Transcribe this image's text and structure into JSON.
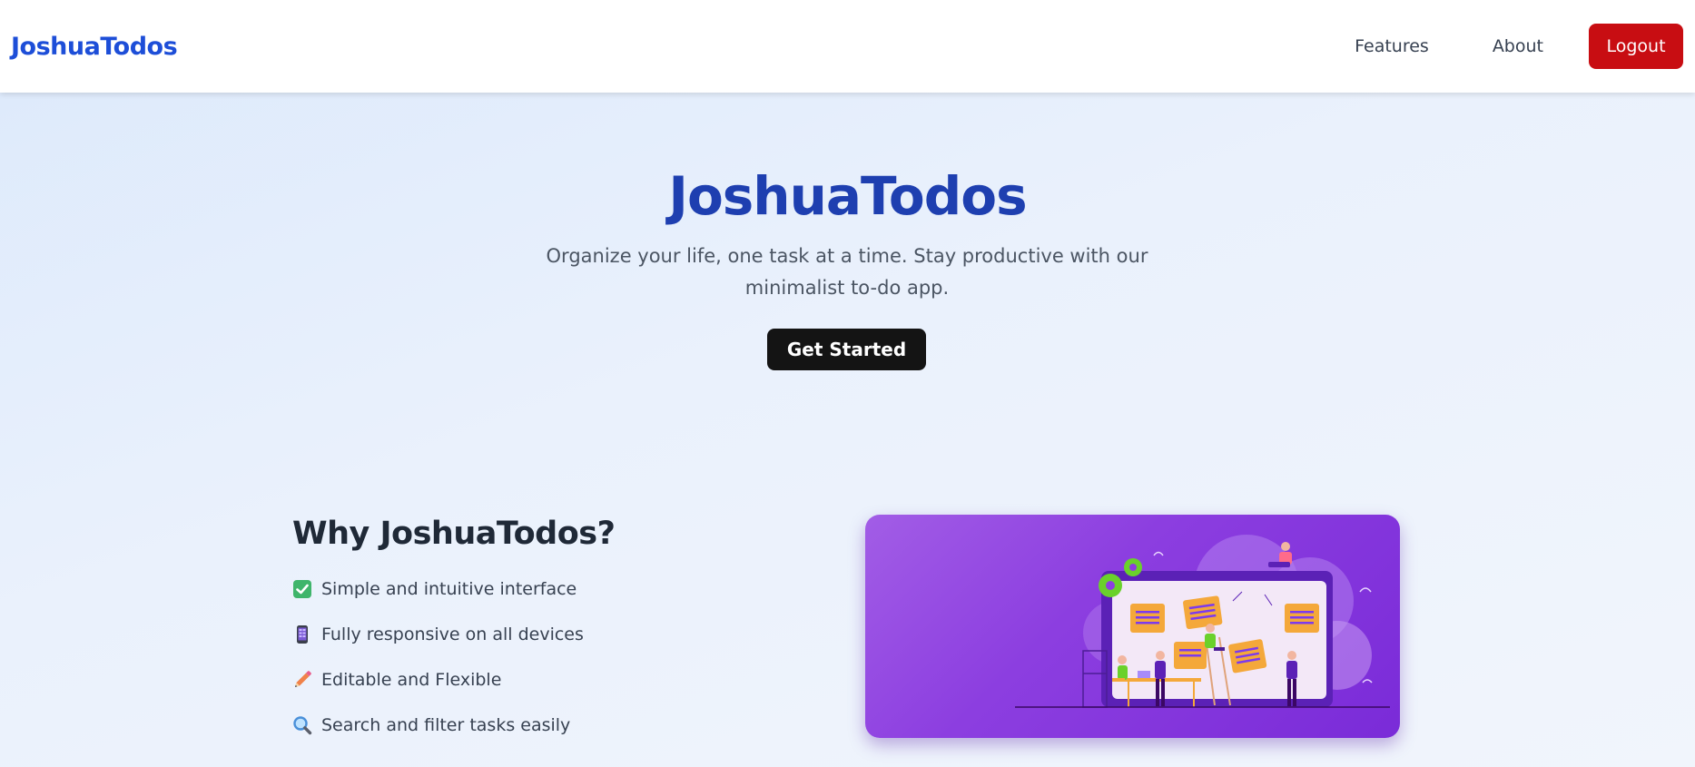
{
  "nav": {
    "brand": "JoshuaTodos",
    "links": [
      {
        "label": "Features"
      },
      {
        "label": "About"
      }
    ],
    "logout_label": "Logout"
  },
  "hero": {
    "title": "JoshuaTodos",
    "subtitle": "Organize your life, one task at a time. Stay productive with our minimalist to-do app.",
    "cta_label": "Get Started"
  },
  "features": {
    "title": "Why JoshuaTodos?",
    "items": [
      {
        "icon": "check-box-icon",
        "label": "Simple and intuitive interface"
      },
      {
        "icon": "mobile-device-icon",
        "label": "Fully responsive on all devices"
      },
      {
        "icon": "pencil-icon",
        "label": "Editable and Flexible"
      },
      {
        "icon": "magnifier-icon",
        "label": "Search and filter tasks easily"
      }
    ]
  },
  "colors": {
    "brand": "#1d4ed8",
    "hero_title": "#1e3fb0",
    "logout": "#c80d12",
    "cta": "#141414",
    "illustration_bg": "#8c3ee0",
    "sticky_note": "#f4a83a"
  }
}
